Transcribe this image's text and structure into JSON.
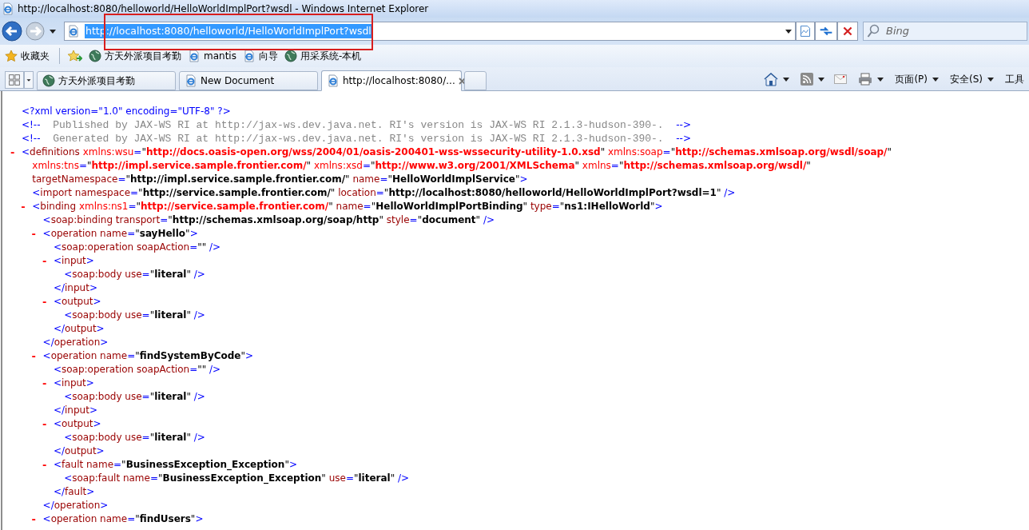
{
  "window": {
    "title": "http://localhost:8080/helloworld/HelloWorldImplPort?wsdl - Windows Internet Explorer"
  },
  "address_bar": {
    "value": "http://localhost:8080/helloworld/HelloWorldImplPort?wsdl",
    "selected": true
  },
  "search": {
    "placeholder": "Bing"
  },
  "favorites_bar": {
    "label": "收藏夹",
    "items": [
      {
        "kind": "globe",
        "label": "方天外派项目考勤"
      },
      {
        "kind": "page",
        "label": "mantis"
      },
      {
        "kind": "page",
        "label": "向导"
      },
      {
        "kind": "globe",
        "label": "用采系统-本机"
      }
    ]
  },
  "tabs": [
    {
      "kind": "globe",
      "label": "方天外派项目考勤",
      "selected": false
    },
    {
      "kind": "page",
      "label": "New Document",
      "selected": false
    },
    {
      "kind": "page",
      "label": "http://localhost:8080/...",
      "selected": true
    }
  ],
  "command_bar": {
    "menus": [
      "页面(P)",
      "安全(S)",
      "工具"
    ]
  },
  "document": {
    "nodes": [
      {
        "lines": [
          [
            {
              "kind": "punct",
              "text": "<?xml version=\"1.0\" encoding=\"UTF-8\" ?>"
            }
          ]
        ]
      },
      {
        "lines": [
          [
            {
              "kind": "punct",
              "text": "<!--"
            },
            {
              "kind": "comment",
              "text": "  Published by JAX-WS RI at http://jax-ws.dev.java.net. RI's version is JAX-WS RI 2.1.3-hudson-390-.  "
            },
            {
              "kind": "punct",
              "text": "-->"
            }
          ]
        ]
      },
      {
        "lines": [
          [
            {
              "kind": "punct",
              "text": "<!--"
            },
            {
              "kind": "comment",
              "text": "  Generated by JAX-WS RI at http://jax-ws.dev.java.net. RI's version is JAX-WS RI 2.1.3-hudson-390-.  "
            },
            {
              "kind": "punct",
              "text": "-->"
            }
          ]
        ]
      },
      {
        "toggle": "-",
        "lines": [
          [
            {
              "kind": "punct",
              "text": "<"
            },
            {
              "kind": "tag",
              "text": "definitions"
            },
            {
              "kind": "nsattr",
              "text": " xmlns:wsu"
            },
            {
              "kind": "punct",
              "text": "="
            },
            {
              "kind": "quote",
              "text": "\""
            },
            {
              "kind": "nsvalue",
              "text": "http://docs.oasis-open.org/wss/2004/01/oasis-200401-wss-wssecurity-utility-1.0.xsd"
            },
            {
              "kind": "quote",
              "text": "\""
            },
            {
              "kind": "nsattr",
              "text": " xmlns:soap"
            },
            {
              "kind": "punct",
              "text": "="
            },
            {
              "kind": "quote",
              "text": "\""
            },
            {
              "kind": "nsvalue",
              "text": "http://schemas.xmlsoap.org/wsdl/soap/"
            },
            {
              "kind": "quote",
              "text": "\""
            }
          ],
          [
            {
              "kind": "nsattr",
              "text": "xmlns:tns"
            },
            {
              "kind": "punct",
              "text": "="
            },
            {
              "kind": "quote",
              "text": "\""
            },
            {
              "kind": "nsvalue",
              "text": "http://impl.service.sample.frontier.com/"
            },
            {
              "kind": "quote",
              "text": "\""
            },
            {
              "kind": "nsattr",
              "text": " xmlns:xsd"
            },
            {
              "kind": "punct",
              "text": "="
            },
            {
              "kind": "quote",
              "text": "\""
            },
            {
              "kind": "nsvalue",
              "text": "http://www.w3.org/2001/XMLSchema"
            },
            {
              "kind": "quote",
              "text": "\""
            },
            {
              "kind": "nsattr",
              "text": " xmlns"
            },
            {
              "kind": "punct",
              "text": "="
            },
            {
              "kind": "quote",
              "text": "\""
            },
            {
              "kind": "nsvalue",
              "text": "http://schemas.xmlsoap.org/wsdl/"
            },
            {
              "kind": "quote",
              "text": "\""
            }
          ],
          [
            {
              "kind": "attr",
              "text": "targetNamespace"
            },
            {
              "kind": "punct",
              "text": "="
            },
            {
              "kind": "quote",
              "text": "\""
            },
            {
              "kind": "value",
              "text": "http://impl.service.sample.frontier.com/"
            },
            {
              "kind": "quote",
              "text": "\""
            },
            {
              "kind": "attr",
              "text": " name"
            },
            {
              "kind": "punct",
              "text": "="
            },
            {
              "kind": "quote",
              "text": "\""
            },
            {
              "kind": "value",
              "text": "HelloWorldImplService"
            },
            {
              "kind": "quote",
              "text": "\""
            },
            {
              "kind": "punct",
              "text": ">"
            }
          ]
        ],
        "children": [
          {
            "lines": [
              [
                {
                  "kind": "punct",
                  "text": "<"
                },
                {
                  "kind": "tag",
                  "text": "import"
                },
                {
                  "kind": "attr",
                  "text": " namespace"
                },
                {
                  "kind": "punct",
                  "text": "="
                },
                {
                  "kind": "quote",
                  "text": "\""
                },
                {
                  "kind": "value",
                  "text": "http://service.sample.frontier.com/"
                },
                {
                  "kind": "quote",
                  "text": "\""
                },
                {
                  "kind": "attr",
                  "text": " location"
                },
                {
                  "kind": "punct",
                  "text": "="
                },
                {
                  "kind": "quote",
                  "text": "\""
                },
                {
                  "kind": "value",
                  "text": "http://localhost:8080/helloworld/HelloWorldImplPort?wsdl=1"
                },
                {
                  "kind": "quote",
                  "text": "\""
                },
                {
                  "kind": "punct",
                  "text": " />"
                }
              ]
            ]
          },
          {
            "toggle": "-",
            "lines": [
              [
                {
                  "kind": "punct",
                  "text": "<"
                },
                {
                  "kind": "tag",
                  "text": "binding"
                },
                {
                  "kind": "nsattr",
                  "text": " xmlns:ns1"
                },
                {
                  "kind": "punct",
                  "text": "="
                },
                {
                  "kind": "quote",
                  "text": "\""
                },
                {
                  "kind": "nsvalue",
                  "text": "http://service.sample.frontier.com/"
                },
                {
                  "kind": "quote",
                  "text": "\""
                },
                {
                  "kind": "attr",
                  "text": " name"
                },
                {
                  "kind": "punct",
                  "text": "="
                },
                {
                  "kind": "quote",
                  "text": "\""
                },
                {
                  "kind": "value",
                  "text": "HelloWorldImplPortBinding"
                },
                {
                  "kind": "quote",
                  "text": "\""
                },
                {
                  "kind": "attr",
                  "text": " type"
                },
                {
                  "kind": "punct",
                  "text": "="
                },
                {
                  "kind": "quote",
                  "text": "\""
                },
                {
                  "kind": "value",
                  "text": "ns1:IHelloWorld"
                },
                {
                  "kind": "quote",
                  "text": "\""
                },
                {
                  "kind": "punct",
                  "text": ">"
                }
              ]
            ],
            "children": [
              {
                "lines": [
                  [
                    {
                      "kind": "punct",
                      "text": "<"
                    },
                    {
                      "kind": "tag",
                      "text": "soap:binding"
                    },
                    {
                      "kind": "attr",
                      "text": " transport"
                    },
                    {
                      "kind": "punct",
                      "text": "="
                    },
                    {
                      "kind": "quote",
                      "text": "\""
                    },
                    {
                      "kind": "value",
                      "text": "http://schemas.xmlsoap.org/soap/http"
                    },
                    {
                      "kind": "quote",
                      "text": "\""
                    },
                    {
                      "kind": "attr",
                      "text": " style"
                    },
                    {
                      "kind": "punct",
                      "text": "="
                    },
                    {
                      "kind": "quote",
                      "text": "\""
                    },
                    {
                      "kind": "value",
                      "text": "document"
                    },
                    {
                      "kind": "quote",
                      "text": "\""
                    },
                    {
                      "kind": "punct",
                      "text": " />"
                    }
                  ]
                ]
              },
              {
                "toggle": "-",
                "lines": [
                  [
                    {
                      "kind": "punct",
                      "text": "<"
                    },
                    {
                      "kind": "tag",
                      "text": "operation"
                    },
                    {
                      "kind": "attr",
                      "text": " name"
                    },
                    {
                      "kind": "punct",
                      "text": "="
                    },
                    {
                      "kind": "quote",
                      "text": "\""
                    },
                    {
                      "kind": "value",
                      "text": "sayHello"
                    },
                    {
                      "kind": "quote",
                      "text": "\""
                    },
                    {
                      "kind": "punct",
                      "text": ">"
                    }
                  ]
                ],
                "children": [
                  {
                    "lines": [
                      [
                        {
                          "kind": "punct",
                          "text": "<"
                        },
                        {
                          "kind": "tag",
                          "text": "soap:operation"
                        },
                        {
                          "kind": "attr",
                          "text": " soapAction"
                        },
                        {
                          "kind": "punct",
                          "text": "="
                        },
                        {
                          "kind": "quote",
                          "text": "\"\""
                        },
                        {
                          "kind": "punct",
                          "text": " />"
                        }
                      ]
                    ]
                  },
                  {
                    "toggle": "-",
                    "lines": [
                      [
                        {
                          "kind": "punct",
                          "text": "<"
                        },
                        {
                          "kind": "tag",
                          "text": "input"
                        },
                        {
                          "kind": "punct",
                          "text": ">"
                        }
                      ]
                    ],
                    "children": [
                      {
                        "lines": [
                          [
                            {
                              "kind": "punct",
                              "text": "<"
                            },
                            {
                              "kind": "tag",
                              "text": "soap:body"
                            },
                            {
                              "kind": "attr",
                              "text": " use"
                            },
                            {
                              "kind": "punct",
                              "text": "="
                            },
                            {
                              "kind": "quote",
                              "text": "\""
                            },
                            {
                              "kind": "value",
                              "text": "literal"
                            },
                            {
                              "kind": "quote",
                              "text": "\""
                            },
                            {
                              "kind": "punct",
                              "text": " />"
                            }
                          ]
                        ]
                      }
                    ],
                    "close": [
                      {
                        "kind": "punct",
                        "text": "</"
                      },
                      {
                        "kind": "tag",
                        "text": "input"
                      },
                      {
                        "kind": "punct",
                        "text": ">"
                      }
                    ]
                  },
                  {
                    "toggle": "-",
                    "lines": [
                      [
                        {
                          "kind": "punct",
                          "text": "<"
                        },
                        {
                          "kind": "tag",
                          "text": "output"
                        },
                        {
                          "kind": "punct",
                          "text": ">"
                        }
                      ]
                    ],
                    "children": [
                      {
                        "lines": [
                          [
                            {
                              "kind": "punct",
                              "text": "<"
                            },
                            {
                              "kind": "tag",
                              "text": "soap:body"
                            },
                            {
                              "kind": "attr",
                              "text": " use"
                            },
                            {
                              "kind": "punct",
                              "text": "="
                            },
                            {
                              "kind": "quote",
                              "text": "\""
                            },
                            {
                              "kind": "value",
                              "text": "literal"
                            },
                            {
                              "kind": "quote",
                              "text": "\""
                            },
                            {
                              "kind": "punct",
                              "text": " />"
                            }
                          ]
                        ]
                      }
                    ],
                    "close": [
                      {
                        "kind": "punct",
                        "text": "</"
                      },
                      {
                        "kind": "tag",
                        "text": "output"
                      },
                      {
                        "kind": "punct",
                        "text": ">"
                      }
                    ]
                  }
                ],
                "close": [
                  {
                    "kind": "punct",
                    "text": "</"
                  },
                  {
                    "kind": "tag",
                    "text": "operation"
                  },
                  {
                    "kind": "punct",
                    "text": ">"
                  }
                ]
              },
              {
                "toggle": "-",
                "lines": [
                  [
                    {
                      "kind": "punct",
                      "text": "<"
                    },
                    {
                      "kind": "tag",
                      "text": "operation"
                    },
                    {
                      "kind": "attr",
                      "text": " name"
                    },
                    {
                      "kind": "punct",
                      "text": "="
                    },
                    {
                      "kind": "quote",
                      "text": "\""
                    },
                    {
                      "kind": "value",
                      "text": "findSystemByCode"
                    },
                    {
                      "kind": "quote",
                      "text": "\""
                    },
                    {
                      "kind": "punct",
                      "text": ">"
                    }
                  ]
                ],
                "children": [
                  {
                    "lines": [
                      [
                        {
                          "kind": "punct",
                          "text": "<"
                        },
                        {
                          "kind": "tag",
                          "text": "soap:operation"
                        },
                        {
                          "kind": "attr",
                          "text": " soapAction"
                        },
                        {
                          "kind": "punct",
                          "text": "="
                        },
                        {
                          "kind": "quote",
                          "text": "\"\""
                        },
                        {
                          "kind": "punct",
                          "text": " />"
                        }
                      ]
                    ]
                  },
                  {
                    "toggle": "-",
                    "lines": [
                      [
                        {
                          "kind": "punct",
                          "text": "<"
                        },
                        {
                          "kind": "tag",
                          "text": "input"
                        },
                        {
                          "kind": "punct",
                          "text": ">"
                        }
                      ]
                    ],
                    "children": [
                      {
                        "lines": [
                          [
                            {
                              "kind": "punct",
                              "text": "<"
                            },
                            {
                              "kind": "tag",
                              "text": "soap:body"
                            },
                            {
                              "kind": "attr",
                              "text": " use"
                            },
                            {
                              "kind": "punct",
                              "text": "="
                            },
                            {
                              "kind": "quote",
                              "text": "\""
                            },
                            {
                              "kind": "value",
                              "text": "literal"
                            },
                            {
                              "kind": "quote",
                              "text": "\""
                            },
                            {
                              "kind": "punct",
                              "text": " />"
                            }
                          ]
                        ]
                      }
                    ],
                    "close": [
                      {
                        "kind": "punct",
                        "text": "</"
                      },
                      {
                        "kind": "tag",
                        "text": "input"
                      },
                      {
                        "kind": "punct",
                        "text": ">"
                      }
                    ]
                  },
                  {
                    "toggle": "-",
                    "lines": [
                      [
                        {
                          "kind": "punct",
                          "text": "<"
                        },
                        {
                          "kind": "tag",
                          "text": "output"
                        },
                        {
                          "kind": "punct",
                          "text": ">"
                        }
                      ]
                    ],
                    "children": [
                      {
                        "lines": [
                          [
                            {
                              "kind": "punct",
                              "text": "<"
                            },
                            {
                              "kind": "tag",
                              "text": "soap:body"
                            },
                            {
                              "kind": "attr",
                              "text": " use"
                            },
                            {
                              "kind": "punct",
                              "text": "="
                            },
                            {
                              "kind": "quote",
                              "text": "\""
                            },
                            {
                              "kind": "value",
                              "text": "literal"
                            },
                            {
                              "kind": "quote",
                              "text": "\""
                            },
                            {
                              "kind": "punct",
                              "text": " />"
                            }
                          ]
                        ]
                      }
                    ],
                    "close": [
                      {
                        "kind": "punct",
                        "text": "</"
                      },
                      {
                        "kind": "tag",
                        "text": "output"
                      },
                      {
                        "kind": "punct",
                        "text": ">"
                      }
                    ]
                  },
                  {
                    "toggle": "-",
                    "lines": [
                      [
                        {
                          "kind": "punct",
                          "text": "<"
                        },
                        {
                          "kind": "tag",
                          "text": "fault"
                        },
                        {
                          "kind": "attr",
                          "text": " name"
                        },
                        {
                          "kind": "punct",
                          "text": "="
                        },
                        {
                          "kind": "quote",
                          "text": "\""
                        },
                        {
                          "kind": "value",
                          "text": "BusinessException_Exception"
                        },
                        {
                          "kind": "quote",
                          "text": "\""
                        },
                        {
                          "kind": "punct",
                          "text": ">"
                        }
                      ]
                    ],
                    "children": [
                      {
                        "lines": [
                          [
                            {
                              "kind": "punct",
                              "text": "<"
                            },
                            {
                              "kind": "tag",
                              "text": "soap:fault"
                            },
                            {
                              "kind": "attr",
                              "text": " name"
                            },
                            {
                              "kind": "punct",
                              "text": "="
                            },
                            {
                              "kind": "quote",
                              "text": "\""
                            },
                            {
                              "kind": "value",
                              "text": "BusinessException_Exception"
                            },
                            {
                              "kind": "quote",
                              "text": "\""
                            },
                            {
                              "kind": "attr",
                              "text": " use"
                            },
                            {
                              "kind": "punct",
                              "text": "="
                            },
                            {
                              "kind": "quote",
                              "text": "\""
                            },
                            {
                              "kind": "value",
                              "text": "literal"
                            },
                            {
                              "kind": "quote",
                              "text": "\""
                            },
                            {
                              "kind": "punct",
                              "text": " />"
                            }
                          ]
                        ]
                      }
                    ],
                    "close": [
                      {
                        "kind": "punct",
                        "text": "</"
                      },
                      {
                        "kind": "tag",
                        "text": "fault"
                      },
                      {
                        "kind": "punct",
                        "text": ">"
                      }
                    ]
                  }
                ],
                "close": [
                  {
                    "kind": "punct",
                    "text": "</"
                  },
                  {
                    "kind": "tag",
                    "text": "operation"
                  },
                  {
                    "kind": "punct",
                    "text": ">"
                  }
                ]
              },
              {
                "toggle": "-",
                "lines": [
                  [
                    {
                      "kind": "punct",
                      "text": "<"
                    },
                    {
                      "kind": "tag",
                      "text": "operation"
                    },
                    {
                      "kind": "attr",
                      "text": " name"
                    },
                    {
                      "kind": "punct",
                      "text": "="
                    },
                    {
                      "kind": "quote",
                      "text": "\""
                    },
                    {
                      "kind": "value",
                      "text": "findUsers"
                    },
                    {
                      "kind": "quote",
                      "text": "\""
                    },
                    {
                      "kind": "punct",
                      "text": ">"
                    }
                  ]
                ]
              }
            ]
          }
        ]
      }
    ]
  }
}
